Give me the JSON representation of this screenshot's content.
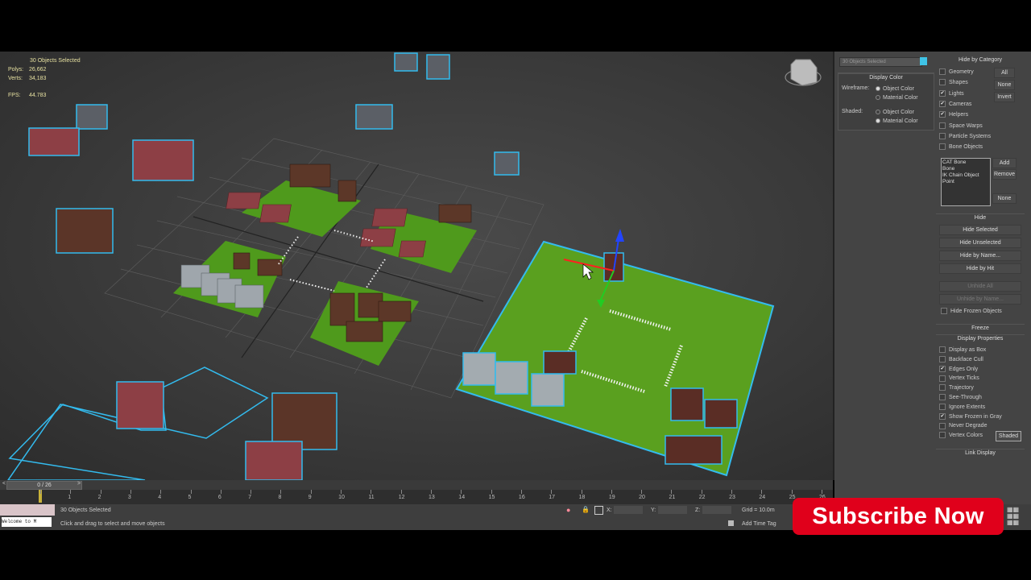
{
  "viewport": {
    "stats": {
      "selected": "30 Objects Selected",
      "polys_label": "Polys:",
      "polys_value": "26,662",
      "verts_label": "Verts:",
      "verts_value": "34,183",
      "fps_label": "FPS:",
      "fps_value": "44.783"
    }
  },
  "display_color": {
    "title": "Display Color",
    "wireframe_label": "Wireframe:",
    "wire_object": "Object Color",
    "wire_material": "Material Color",
    "shaded_label": "Shaded:",
    "shaded_object": "Object Color",
    "shaded_material": "Material Color"
  },
  "name_field": "30 Objects Selected",
  "hide_by_category": {
    "title": "Hide by Category",
    "items": [
      {
        "label": "Geometry",
        "checked": false
      },
      {
        "label": "Shapes",
        "checked": false
      },
      {
        "label": "Lights",
        "checked": true
      },
      {
        "label": "Cameras",
        "checked": true
      },
      {
        "label": "Helpers",
        "checked": true
      },
      {
        "label": "Space Warps",
        "checked": false
      },
      {
        "label": "Particle Systems",
        "checked": false
      },
      {
        "label": "Bone Objects",
        "checked": false
      }
    ],
    "all": "All",
    "none": "None",
    "invert": "Invert",
    "list": [
      "CAT Bone",
      "Bone",
      "IK Chain Object",
      "Point"
    ],
    "add": "Add",
    "remove": "Remove",
    "none2": "None"
  },
  "hide": {
    "title": "Hide",
    "hide_selected": "Hide Selected",
    "hide_unselected": "Hide Unselected",
    "hide_by_name": "Hide by Name...",
    "hide_by_hit": "Hide by Hit",
    "unhide_all": "Unhide All",
    "unhide_by_name": "Unhide by Name...",
    "hide_frozen": "Hide Frozen Objects"
  },
  "freeze": {
    "title": "Freeze"
  },
  "display_properties": {
    "title": "Display Properties",
    "items": [
      {
        "label": "Display as Box",
        "checked": false
      },
      {
        "label": "Backface Cull",
        "checked": false
      },
      {
        "label": "Edges Only",
        "checked": true
      },
      {
        "label": "Vertex Ticks",
        "checked": false
      },
      {
        "label": "Trajectory",
        "checked": false
      },
      {
        "label": "See-Through",
        "checked": false
      },
      {
        "label": "Ignore Extents",
        "checked": false
      },
      {
        "label": "Show Frozen in Gray",
        "checked": true
      },
      {
        "label": "Never Degrade",
        "checked": false
      },
      {
        "label": "Vertex Colors",
        "checked": false
      }
    ],
    "shaded": "Shaded"
  },
  "link_display": {
    "title": "Link Display"
  },
  "timeline": {
    "frame": "0 / 26",
    "prev": "<",
    "next": ">",
    "ticks": [
      "0",
      "1",
      "2",
      "3",
      "4",
      "5",
      "6",
      "7",
      "8",
      "9",
      "10",
      "11",
      "12",
      "13",
      "14",
      "15",
      "16",
      "17",
      "18",
      "19",
      "20",
      "21",
      "22",
      "23",
      "24",
      "25",
      "26"
    ]
  },
  "status": {
    "listener": "Welcome to M",
    "selected": "30 Objects Selected",
    "prompt": "Click and drag to select and move objects",
    "x_label": "X:",
    "y_label": "Y:",
    "z_label": "Z:",
    "grid": "Grid = 10.0m",
    "add_time_tag": "Add Time Tag"
  },
  "subscribe": "Subscribe Now",
  "colors": {
    "selection_outline": "#33bbee",
    "ground": "#5aa01f",
    "roof": "#a0525a",
    "status_text": "#e6e0a0",
    "subscribe_bg": "#e0001b"
  }
}
